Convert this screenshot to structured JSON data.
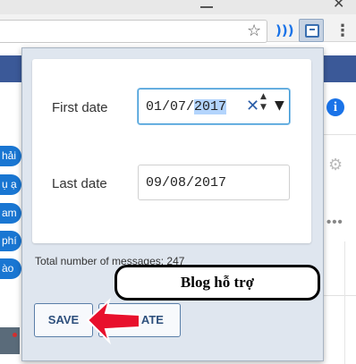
{
  "browser": {
    "close_glyph": "✕",
    "star_icon": "☆",
    "wave_icon": ")))",
    "menu_icon": "⋮"
  },
  "background_page": {
    "pills": [
      "hải",
      "ụ ạ",
      "am",
      "phí",
      "ào"
    ],
    "info_icon": "i",
    "gear_icon": "⚙",
    "dots": "•••"
  },
  "popup": {
    "first_date_label": "First date",
    "first_date_prefix": "01/07/",
    "first_date_year": "2017",
    "clear_icon": "✕",
    "spin_up": "▲",
    "spin_down": "▼",
    "dropdown_icon": "▼",
    "last_date_label": "Last date",
    "last_date_value": "09/08/2017",
    "total_messages": "Total number of messages:  247",
    "save_label": "SAVE",
    "donate_label": "DONATE"
  },
  "overlay": {
    "caption": "Blog hỗ trợ",
    "arrow_color": "#e8102c"
  },
  "colors": {
    "facebook_blue": "#3b5998",
    "accent_blue": "#1976d2",
    "popup_bg": "#dfe6ef"
  }
}
